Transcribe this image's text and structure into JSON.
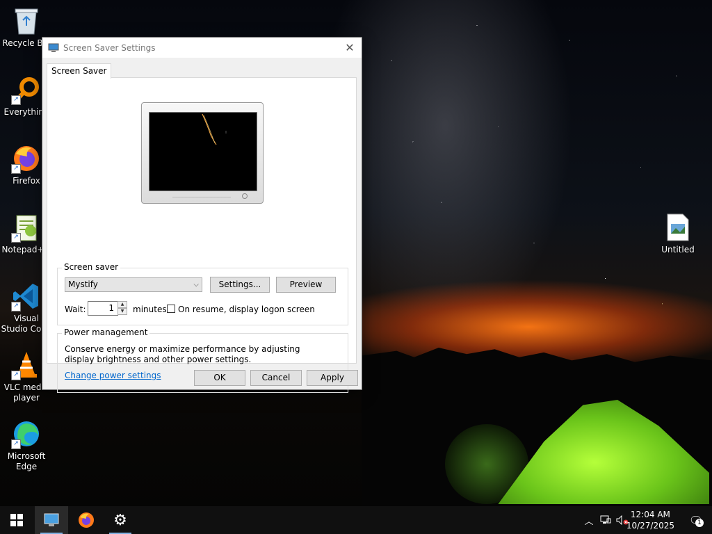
{
  "desktop": {
    "icons_left": [
      {
        "label": "Recycle Bin",
        "shortcut": false
      },
      {
        "label": "Everything",
        "shortcut": true
      },
      {
        "label": "Firefox",
        "shortcut": true
      },
      {
        "label": "Notepad++",
        "shortcut": true
      },
      {
        "label": "Visual Studio Code",
        "shortcut": true
      },
      {
        "label": "VLC media player",
        "shortcut": true
      },
      {
        "label": "Microsoft Edge",
        "shortcut": true
      }
    ],
    "icon_right": {
      "label": "Untitled"
    }
  },
  "dialog": {
    "title": "Screen Saver Settings",
    "close_glyph": "✕",
    "tab_label": "Screen Saver",
    "screen_saver_group": {
      "label": "Screen saver",
      "selected": "Mystify",
      "settings_button": "Settings...",
      "preview_button": "Preview",
      "wait_label": "Wait:",
      "wait_value": "1",
      "minutes_label": "minutes",
      "resume_checkbox_label": "On resume, display logon screen",
      "resume_checked": false
    },
    "power_group": {
      "label": "Power management",
      "description": "Conserve energy or maximize performance by adjusting display brightness and other power settings.",
      "link": "Change power settings"
    },
    "buttons": {
      "ok": "OK",
      "cancel": "Cancel",
      "apply": "Apply"
    }
  },
  "taskbar": {
    "items": [
      "start-icon",
      "display-settings-icon",
      "firefox-icon",
      "settings-gear-icon"
    ],
    "clock": {
      "time": "12:04 AM",
      "date": "10/27/2025"
    },
    "notification_count": "1"
  },
  "colors": {
    "link": "#0066cc",
    "taskbar": "#101010",
    "dialog_bg": "#f0f0f0"
  }
}
